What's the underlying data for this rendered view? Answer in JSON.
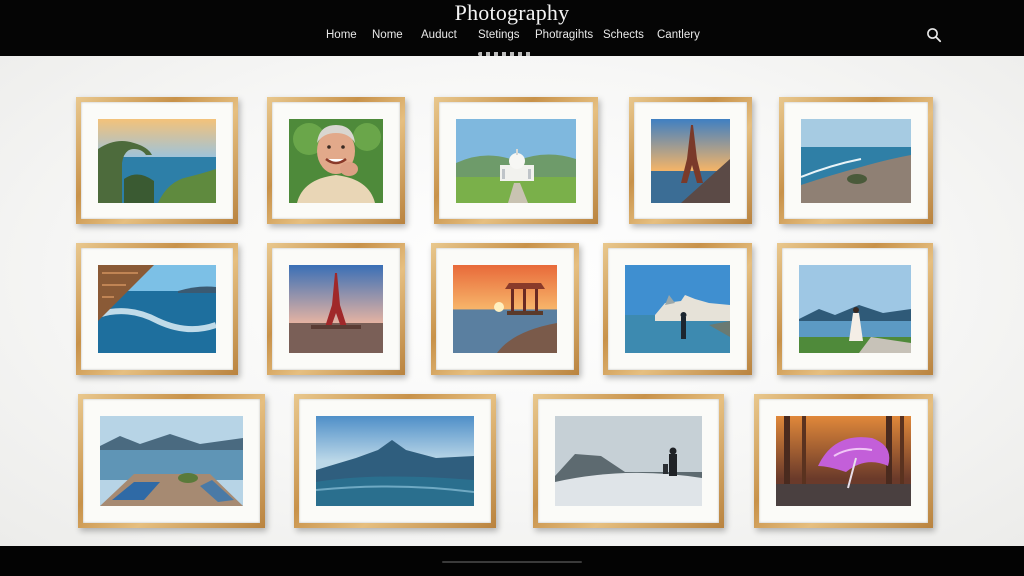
{
  "header": {
    "title": "Photography",
    "nav": [
      "Home",
      "Nome",
      "Auduct",
      "Stetings",
      "Photragihts",
      "Schects",
      "Cantlery"
    ],
    "search_icon": "search-icon"
  },
  "colors": {
    "header_bg": "#050505",
    "wall_bg": "#f7f7f6",
    "frame_gold": "#c8924a",
    "mat": "#fbfbf8"
  },
  "gallery": [
    {
      "subject": "sea-arch-coast-icon"
    },
    {
      "subject": "smiling-man-portrait-icon"
    },
    {
      "subject": "white-domed-palace-icon"
    },
    {
      "subject": "eiffel-tower-sunset-icon"
    },
    {
      "subject": "rocky-pier-ocean-icon"
    },
    {
      "subject": "bridge-ocean-waves-icon"
    },
    {
      "subject": "eiffel-tower-dusk-icon"
    },
    {
      "subject": "pavilion-sunset-shore-icon"
    },
    {
      "subject": "lakeside-city-walker-icon"
    },
    {
      "subject": "woman-by-lake-icon"
    },
    {
      "subject": "boats-dock-mountains-icon"
    },
    {
      "subject": "misty-mountain-lake-icon"
    },
    {
      "subject": "person-on-snowy-hill-icon"
    },
    {
      "subject": "purple-umbrella-forest-icon"
    }
  ]
}
